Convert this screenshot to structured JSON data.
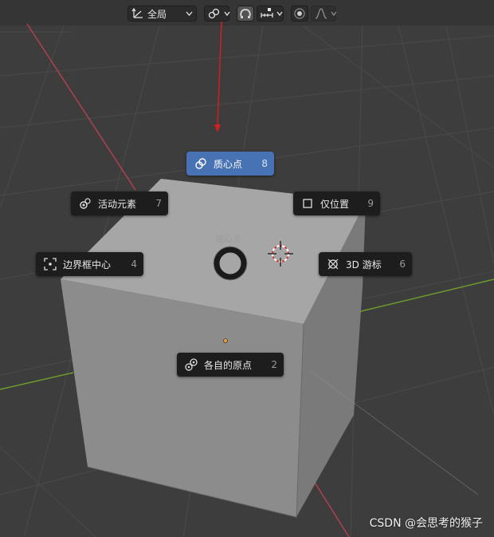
{
  "toolbar": {
    "orientation_value": "全局",
    "orientation_icon": "transform-orientation-icon",
    "pivot_icon": "pivot-point-icon",
    "snap_icon": "snap-magnet-icon",
    "snap_increment_icon": "snap-increment-icon",
    "proportional_icon": "proportional-edit-icon",
    "falloff_icon": "falloff-curve-icon"
  },
  "pie_menu": {
    "title": "轴心点",
    "items": [
      {
        "label": "质心点",
        "key": "8",
        "icon": "median-point-icon",
        "selected": true
      },
      {
        "label": "活动元素",
        "key": "7",
        "icon": "active-element-icon",
        "selected": false
      },
      {
        "label": "仅位置",
        "key": "9",
        "icon": "checkbox-icon",
        "selected": false
      },
      {
        "label": "边界框中心",
        "key": "4",
        "icon": "bounding-box-center-icon",
        "selected": false
      },
      {
        "label": "3D 游标",
        "key": "6",
        "icon": "3d-cursor-icon",
        "selected": false
      },
      {
        "label": "各自的原点",
        "key": "2",
        "icon": "individual-origins-icon",
        "selected": false
      }
    ]
  },
  "watermark": "CSDN @会思考的猴子",
  "colors": {
    "background": "#3d3d3d",
    "cube_top": "#a6a6a6",
    "cube_front": "#8b8b8b",
    "cube_side": "#7b7b7b",
    "x_axis": "#b04050",
    "y_axis": "#6e9a2c",
    "selected": "#4772b3",
    "pie_item_bg": "#1d1d1d"
  }
}
